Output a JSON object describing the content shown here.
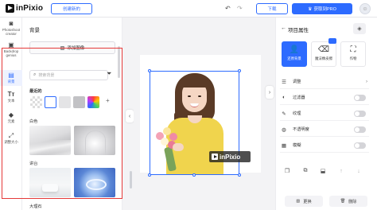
{
  "app": {
    "name": "inPixio"
  },
  "topbar": {
    "create_label": "创建新的",
    "download_label": "下载",
    "pro_label": "获取到PRO",
    "undo_icon": "undo-icon",
    "redo_icon": "redo-icon"
  },
  "rail": {
    "items": [
      {
        "label": "Photoshoot creator",
        "icon": "camera-icon"
      },
      {
        "label": "Backdrop genius",
        "icon": "image-icon"
      },
      {
        "label": "背景",
        "icon": "background-icon",
        "active": true
      },
      {
        "label": "文本",
        "icon": "text-icon"
      },
      {
        "label": "元素",
        "icon": "elements-icon"
      },
      {
        "label": "调整大小",
        "icon": "resize-icon"
      }
    ]
  },
  "left_panel": {
    "title": "背景",
    "upload_label": "添加图像",
    "search_placeholder": "搜索背景",
    "section_recent": "最近的",
    "section_white": "白色",
    "section_studio": "讲台",
    "section_bottom": "大理石",
    "colors": {
      "white": "#ffffff",
      "light_gray": "#e4e4e6",
      "gray": "#c2c2c5",
      "accent": "#2d6bff",
      "highlight": "#e53939"
    }
  },
  "canvas": {
    "watermark_text": "inPixio"
  },
  "right_panel": {
    "title": "项目属性",
    "tools": [
      {
        "label": "还原背景",
        "icon": "person-icon",
        "active": true
      },
      {
        "label": "魔法橡皮擦",
        "icon": "eraser-icon"
      },
      {
        "label": "作物",
        "icon": "crop-icon"
      }
    ],
    "properties": [
      {
        "label": "调整",
        "icon": "sliders-icon",
        "kind": "chevron"
      },
      {
        "label": "过滤器",
        "icon": "filter-icon",
        "kind": "toggle"
      },
      {
        "label": "纹理",
        "icon": "texture-icon",
        "kind": "toggle"
      },
      {
        "label": "不透明度",
        "icon": "opacity-icon",
        "kind": "toggle"
      },
      {
        "label": "模糊",
        "icon": "blur-icon",
        "kind": "toggle"
      }
    ],
    "bottom": {
      "replace_label": "更换",
      "delete_label": "删除"
    }
  }
}
